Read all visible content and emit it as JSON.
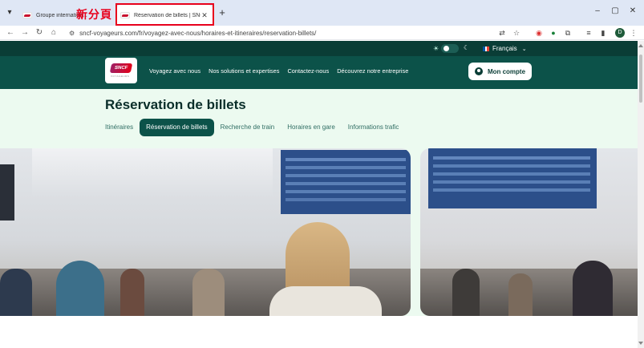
{
  "browser": {
    "tab_list_icon": "chevron-down-icon",
    "tabs": [
      {
        "title": "Groupe internation...",
        "active": false
      },
      {
        "title": "Réservation de billets | SNCF",
        "active": true
      }
    ],
    "annotation": "新分頁",
    "close_glyph": "✕",
    "new_tab_glyph": "+",
    "window_controls": [
      "–",
      "▢",
      "✕"
    ],
    "url": "sncf-voyageurs.com/fr/voyagez-avec-nous/horaires-et-itineraires/reservation-billets/",
    "profile_initial": "D"
  },
  "site": {
    "accent_dark": "#0a3d36",
    "accent_nav": "#0c5249",
    "page_bg": "#ecfaf0",
    "language": "Français",
    "logo_text": "SNCF",
    "logo_sub": "VOYAGEURS",
    "nav": [
      "Voyagez avec nous",
      "Nos solutions et expertises",
      "Contactez-nous",
      "Découvrez notre entreprise"
    ],
    "account_label": "Mon compte",
    "title": "Réservation de billets",
    "subtabs": [
      {
        "label": "Itinéraires",
        "active": false
      },
      {
        "label": "Réservation de billets",
        "active": true
      },
      {
        "label": "Recherche de train",
        "active": false
      },
      {
        "label": "Horaires en gare",
        "active": false
      },
      {
        "label": "Informations trafic",
        "active": false
      }
    ]
  }
}
